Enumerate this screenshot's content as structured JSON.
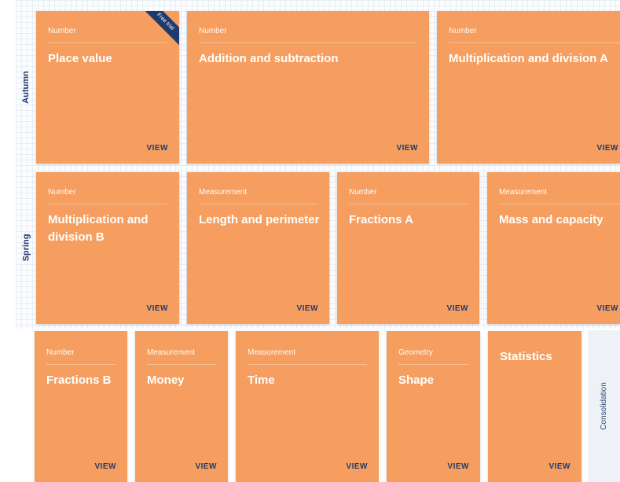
{
  "terms": {
    "autumn": "Autumn",
    "spring": "Spring",
    "consolidation": "Consolidation"
  },
  "view_label": "VIEW",
  "ribbon": "Free trial",
  "autumn": [
    {
      "cat": "Number",
      "title": "Place value"
    },
    {
      "cat": "Number",
      "title": "Addition and subtraction"
    },
    {
      "cat": "Number",
      "title": "Multiplication and division A"
    }
  ],
  "spring": [
    {
      "cat": "Number",
      "title": "Multiplication and division B"
    },
    {
      "cat": "Measurement",
      "title": "Length and perimeter"
    },
    {
      "cat": "Number",
      "title": "Fractions A"
    },
    {
      "cat": "Measurement",
      "title": "Mass and capacity"
    }
  ],
  "summer": [
    {
      "cat": "Number",
      "title": "Fractions B"
    },
    {
      "cat": "Measurement",
      "title": "Money"
    },
    {
      "cat": "Measurement",
      "title": "Time"
    },
    {
      "cat": "Geometry",
      "title": "Shape"
    },
    {
      "cat": "",
      "title": "Statistics"
    }
  ],
  "colors": {
    "card": "#f59e5f",
    "navy": "#1f3b6e"
  }
}
